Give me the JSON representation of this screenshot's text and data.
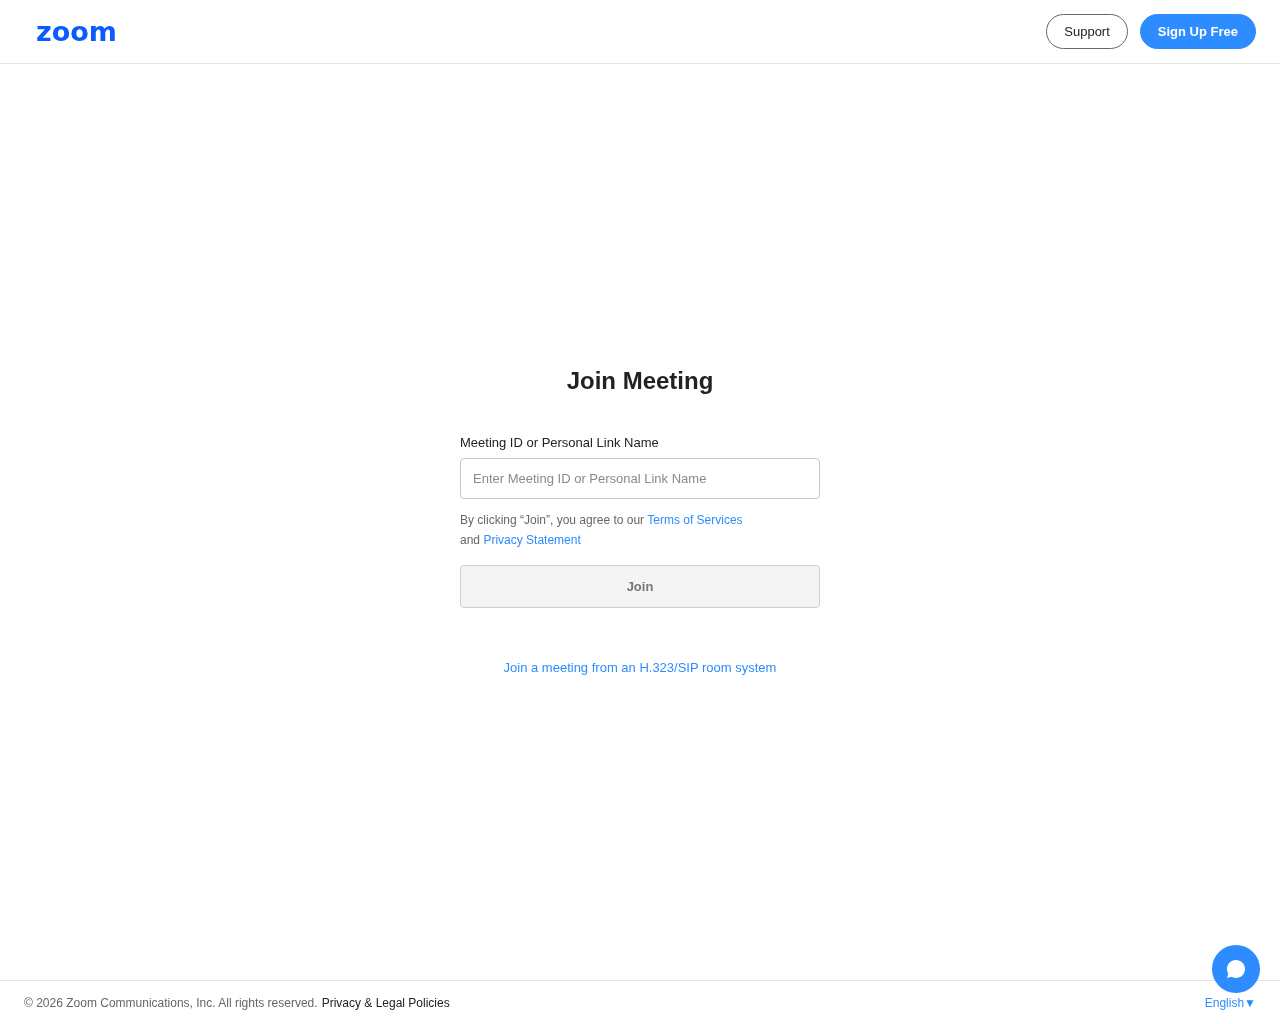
{
  "header": {
    "logo": "zoom",
    "buttons": [
      {
        "label": "Support",
        "kind": "outline"
      },
      {
        "label": "Sign Up Free",
        "kind": "primary"
      }
    ]
  },
  "join": {
    "title": "Join Meeting",
    "field_label": "Meeting ID or Personal Link Name",
    "placeholder": "Enter Meeting ID or Personal Link Name",
    "agreement": {
      "text": "By clicking “Join”, you agree to our",
      "terms_link": "Terms of Services",
      "and": "and",
      "privacy_link": "Privacy Statement"
    },
    "button": {
      "label": "Join",
      "disabled": true
    },
    "room_link": "Join a meeting from an H.323/SIP room system"
  },
  "footer": {
    "copyright": "© 2026 Zoom Communications, Inc. All rights reserved.",
    "legal_link": "Privacy & Legal Policies",
    "language": "English",
    "language_caret": "▼"
  }
}
